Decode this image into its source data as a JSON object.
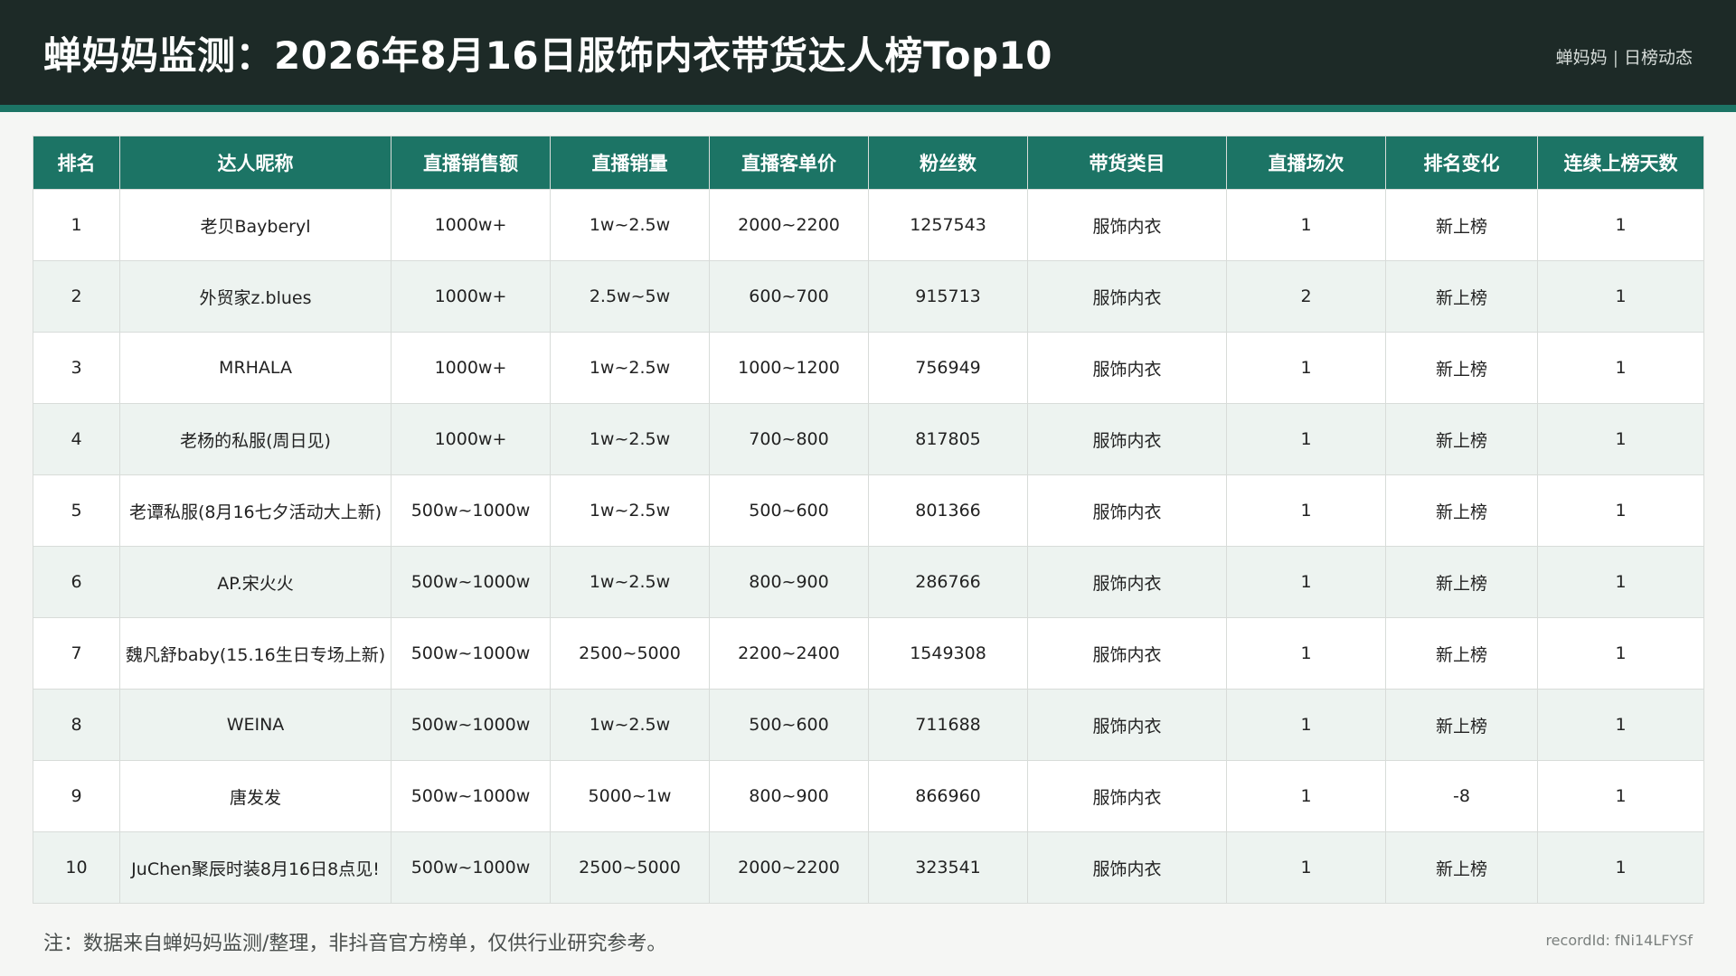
{
  "header": {
    "title": "蝉妈妈监测：2026年8月16日服饰内衣带货达人榜Top10",
    "brand": "蝉妈妈",
    "brand_sep": "|",
    "brand_sub": "日榜动态"
  },
  "table": {
    "columns": [
      "排名",
      "达人昵称",
      "直播销售额",
      "直播销量",
      "直播客单价",
      "粉丝数",
      "带货类目",
      "直播场次",
      "排名变化",
      "连续上榜天数"
    ],
    "rows": [
      [
        "1",
        "老贝Bayberyl",
        "1000w+",
        "1w~2.5w",
        "2000~2200",
        "1257543",
        "服饰内衣",
        "1",
        "新上榜",
        "1"
      ],
      [
        "2",
        "外贸家z.blues",
        "1000w+",
        "2.5w~5w",
        "600~700",
        "915713",
        "服饰内衣",
        "2",
        "新上榜",
        "1"
      ],
      [
        "3",
        "MRHALA",
        "1000w+",
        "1w~2.5w",
        "1000~1200",
        "756949",
        "服饰内衣",
        "1",
        "新上榜",
        "1"
      ],
      [
        "4",
        "老杨的私服(周日见)",
        "1000w+",
        "1w~2.5w",
        "700~800",
        "817805",
        "服饰内衣",
        "1",
        "新上榜",
        "1"
      ],
      [
        "5",
        "老谭私服(8月16七夕活动大上新)",
        "500w~1000w",
        "1w~2.5w",
        "500~600",
        "801366",
        "服饰内衣",
        "1",
        "新上榜",
        "1"
      ],
      [
        "6",
        "AP.宋火火",
        "500w~1000w",
        "1w~2.5w",
        "800~900",
        "286766",
        "服饰内衣",
        "1",
        "新上榜",
        "1"
      ],
      [
        "7",
        "魏凡舒baby(15.16生日专场上新)",
        "500w~1000w",
        "2500~5000",
        "2200~2400",
        "1549308",
        "服饰内衣",
        "1",
        "新上榜",
        "1"
      ],
      [
        "8",
        "WEINA",
        "500w~1000w",
        "1w~2.5w",
        "500~600",
        "711688",
        "服饰内衣",
        "1",
        "新上榜",
        "1"
      ],
      [
        "9",
        "唐发发",
        "500w~1000w",
        "5000~1w",
        "800~900",
        "866960",
        "服饰内衣",
        "1",
        "-8",
        "1"
      ],
      [
        "10",
        "JuChen聚辰时装8月16日8点见!",
        "500w~1000w",
        "2500~5000",
        "2000~2200",
        "323541",
        "服饰内衣",
        "1",
        "新上榜",
        "1"
      ]
    ]
  },
  "footer": {
    "note": "注：数据来自蝉妈妈监测/整理，非抖音官方榜单，仅供行业研究参考。",
    "record": "recordId: fNi14LFYSf"
  }
}
